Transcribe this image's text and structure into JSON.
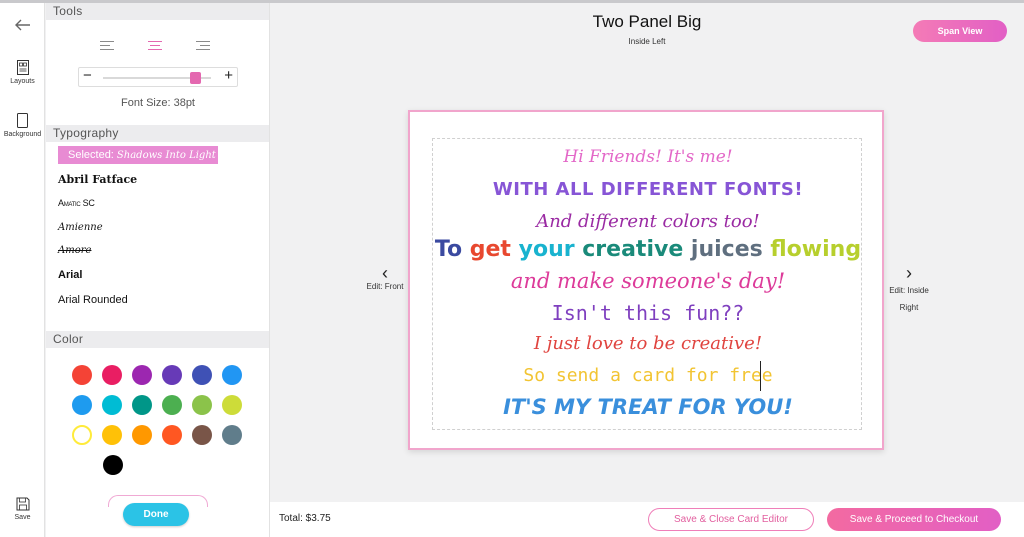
{
  "rail": {
    "layouts_label": "Layouts",
    "background_label": "Background",
    "save_label": "Save"
  },
  "tools": {
    "heading": "Tools",
    "alignment": "center",
    "font_size_fraction": 0.85,
    "font_size_label": "Font Size: 38pt"
  },
  "typography": {
    "heading": "Typography",
    "selected_label": "Selected: ",
    "selected_font": "Shadows Into Light",
    "fonts": [
      "Abril Fatface",
      "Amatic SC",
      "Amienne",
      "Amore",
      "Arial",
      "Arial Rounded"
    ]
  },
  "color": {
    "heading": "Color",
    "swatches": [
      "#f44336",
      "#e91e63",
      "#9c27b0",
      "#673ab7",
      "#3f51b5",
      "#2196f3",
      "#1e9bef",
      "#00bcd4",
      "#009688",
      "#4caf50",
      "#8bc34a",
      "#cddc39",
      "#ffeb3b",
      "#ffc107",
      "#ff9800",
      "#ff5722",
      "#795548",
      "#607d8b",
      "#000000"
    ],
    "selected_index": 12
  },
  "done_label": "Done",
  "main": {
    "title": "Two Panel Big",
    "subtitle": "Inside Left",
    "span_view_label": "Span View",
    "nav_left_label": "Edit: Front",
    "nav_right_label": "Edit: Inside Right"
  },
  "card": {
    "line1": "Hi Friends! It's me!",
    "line2": "WITH ALL DIFFERENT FONTS!",
    "line3": "And different colors too!",
    "line4": [
      {
        "text": "To ",
        "color": "#3b4aa0"
      },
      {
        "text": "get ",
        "color": "#e8482f"
      },
      {
        "text": "your ",
        "color": "#19b3cf"
      },
      {
        "text": "creative ",
        "color": "#1a8a7a"
      },
      {
        "text": "juices ",
        "color": "#5f6f7f"
      },
      {
        "text": "flowing",
        "color": "#b7cf2d"
      }
    ],
    "line5": "and make someone's day!",
    "line6": "Isn't this fun??",
    "line7": "I just love to be creative!",
    "line8": "So send a card for free",
    "line9": "IT'S MY TREAT FOR YOU!"
  },
  "footer": {
    "total": "Total: $3.75",
    "save_close_label": "Save & Close Card Editor",
    "save_proceed_label": "Save & Proceed to Checkout"
  }
}
